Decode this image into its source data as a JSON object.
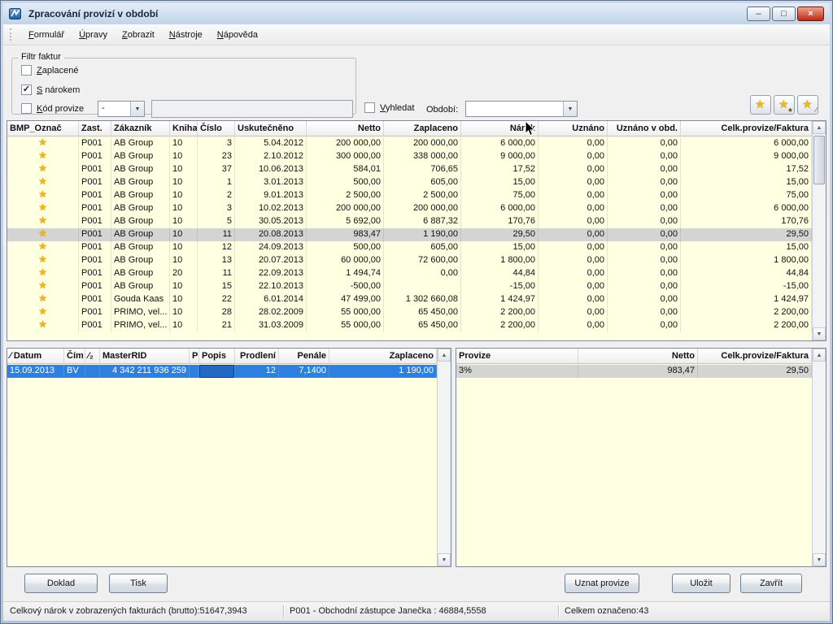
{
  "window": {
    "title": "Zpracování provizí v období"
  },
  "glyphs": {
    "check": "✓",
    "dropdown": "▼",
    "scroll_up": "▲",
    "scroll_down": "▼",
    "minimize": "–",
    "maximize": "□",
    "close": "×"
  },
  "menu": {
    "items": [
      {
        "label": "Formulář",
        "accel": 0
      },
      {
        "label": "Úpravy",
        "accel": 0
      },
      {
        "label": "Zobrazit",
        "accel": 0
      },
      {
        "label": "Nástroje",
        "accel": 0
      },
      {
        "label": "Nápověda",
        "accel": 0
      }
    ]
  },
  "filter": {
    "group_label": "Filtr faktur",
    "zaplacene": {
      "label": "Zaplacené",
      "accel": 0,
      "checked": false
    },
    "s_narokem": {
      "label": "S nárokem",
      "accel": 0,
      "checked": true
    },
    "kod_provize": {
      "label": "Kód provize",
      "accel": 0,
      "checked": false
    },
    "kod_provize_select": {
      "value": "-"
    },
    "kod_provize_input": {
      "value": ""
    },
    "vyhledat": {
      "label": "Vyhledat",
      "accel": 0,
      "checked": false
    },
    "obdobi_label": "Období:",
    "obdobi_select": {
      "value": ""
    }
  },
  "star_toolbar": {
    "buttons": [
      {
        "icon": "star-icon",
        "glyph": "★",
        "overlay": ""
      },
      {
        "icon": "star-plus-icon",
        "glyph": "★",
        "overlay": "★"
      },
      {
        "icon": "star-edit-icon",
        "glyph": "★",
        "overlay": "∕"
      }
    ]
  },
  "invoice_table": {
    "columns": [
      "BMP_Označ",
      "Zast.",
      "Zákazník",
      "Kniha",
      "Číslo",
      "Uskutečněno",
      "Netto",
      "Zaplaceno",
      "Nárok",
      "Uznáno",
      "Uznáno v obd.",
      "Celk.provize/Faktura"
    ],
    "row_icon": {
      "name": "star-icon",
      "glyph": "★"
    },
    "rows": [
      {
        "selected": false,
        "values": [
          "P001",
          "AB Group",
          "10",
          "3",
          "5.04.2012",
          "200 000,00",
          "200 000,00",
          "6 000,00",
          "0,00",
          "0,00",
          "6 000,00"
        ]
      },
      {
        "selected": false,
        "values": [
          "P001",
          "AB Group",
          "10",
          "23",
          "2.10.2012",
          "300 000,00",
          "338 000,00",
          "9 000,00",
          "0,00",
          "0,00",
          "9 000,00"
        ]
      },
      {
        "selected": false,
        "values": [
          "P001",
          "AB Group",
          "10",
          "37",
          "10.06.2013",
          "584,01",
          "706,65",
          "17,52",
          "0,00",
          "0,00",
          "17,52"
        ]
      },
      {
        "selected": false,
        "values": [
          "P001",
          "AB Group",
          "10",
          "1",
          "3.01.2013",
          "500,00",
          "605,00",
          "15,00",
          "0,00",
          "0,00",
          "15,00"
        ]
      },
      {
        "selected": false,
        "values": [
          "P001",
          "AB Group",
          "10",
          "2",
          "9.01.2013",
          "2 500,00",
          "2 500,00",
          "75,00",
          "0,00",
          "0,00",
          "75,00"
        ]
      },
      {
        "selected": false,
        "values": [
          "P001",
          "AB Group",
          "10",
          "3",
          "10.02.2013",
          "200 000,00",
          "200 000,00",
          "6 000,00",
          "0,00",
          "0,00",
          "6 000,00"
        ]
      },
      {
        "selected": false,
        "values": [
          "P001",
          "AB Group",
          "10",
          "5",
          "30.05.2013",
          "5 692,00",
          "6 887,32",
          "170,76",
          "0,00",
          "0,00",
          "170,76"
        ]
      },
      {
        "selected": true,
        "values": [
          "P001",
          "AB Group",
          "10",
          "11",
          "20.08.2013",
          "983,47",
          "1 190,00",
          "29,50",
          "0,00",
          "0,00",
          "29,50"
        ]
      },
      {
        "selected": false,
        "values": [
          "P001",
          "AB Group",
          "10",
          "12",
          "24.09.2013",
          "500,00",
          "605,00",
          "15,00",
          "0,00",
          "0,00",
          "15,00"
        ]
      },
      {
        "selected": false,
        "values": [
          "P001",
          "AB Group",
          "10",
          "13",
          "20.07.2013",
          "60 000,00",
          "72 600,00",
          "1 800,00",
          "0,00",
          "0,00",
          "1 800,00"
        ]
      },
      {
        "selected": false,
        "values": [
          "P001",
          "AB Group",
          "20",
          "11",
          "22.09.2013",
          "1 494,74",
          "0,00",
          "44,84",
          "0,00",
          "0,00",
          "44,84"
        ]
      },
      {
        "selected": false,
        "values": [
          "P001",
          "AB Group",
          "10",
          "15",
          "22.10.2013",
          "-500,00",
          "",
          "-15,00",
          "0,00",
          "0,00",
          "-15,00"
        ]
      },
      {
        "selected": false,
        "values": [
          "P001",
          "Gouda Kaas",
          "10",
          "22",
          "6.01.2014",
          "47 499,00",
          "1 302 660,08",
          "1 424,97",
          "0,00",
          "0,00",
          "1 424,97"
        ]
      },
      {
        "selected": false,
        "values": [
          "P001",
          "PRIMO, vel...",
          "10",
          "28",
          "28.02.2009",
          "55 000,00",
          "65 450,00",
          "2 200,00",
          "0,00",
          "0,00",
          "2 200,00"
        ]
      },
      {
        "selected": false,
        "values": [
          "P001",
          "PRIMO, vel...",
          "10",
          "21",
          "31.03.2009",
          "55 000,00",
          "65 450,00",
          "2 200,00",
          "0,00",
          "0,00",
          "2 200,00"
        ]
      }
    ]
  },
  "payments_table": {
    "headers": [
      "∕ Datum",
      "Čím",
      "∕₂",
      "MasterRID",
      "P",
      "Popis",
      "Prodlení",
      "Penále",
      "Zaplaceno"
    ],
    "rows": [
      {
        "selected": true,
        "focused_col": 5,
        "values": [
          "15.09.2013",
          "BV",
          "",
          "4 342 211 936 259",
          "",
          "",
          "12",
          "7,1400",
          "1 190,00"
        ]
      }
    ]
  },
  "commission_table": {
    "headers": [
      "Provize",
      "Netto",
      "Celk.provize/Faktura"
    ],
    "rows": [
      {
        "selected": true,
        "values": [
          "3%",
          "983,47",
          "29,50"
        ]
      }
    ]
  },
  "action_buttons": {
    "doklad": "Doklad",
    "tisk": "Tisk",
    "uznat_provize": "Uznat provize",
    "ulozit": "Uložit",
    "zavrit": "Zavřít"
  },
  "status_bar": {
    "sections": [
      "Celkový nárok v zobrazených fakturách (brutto):51647,3943",
      "P001 - Obchodní zástupce Janečka : 46884,5558",
      "Celkem označeno:43"
    ]
  }
}
